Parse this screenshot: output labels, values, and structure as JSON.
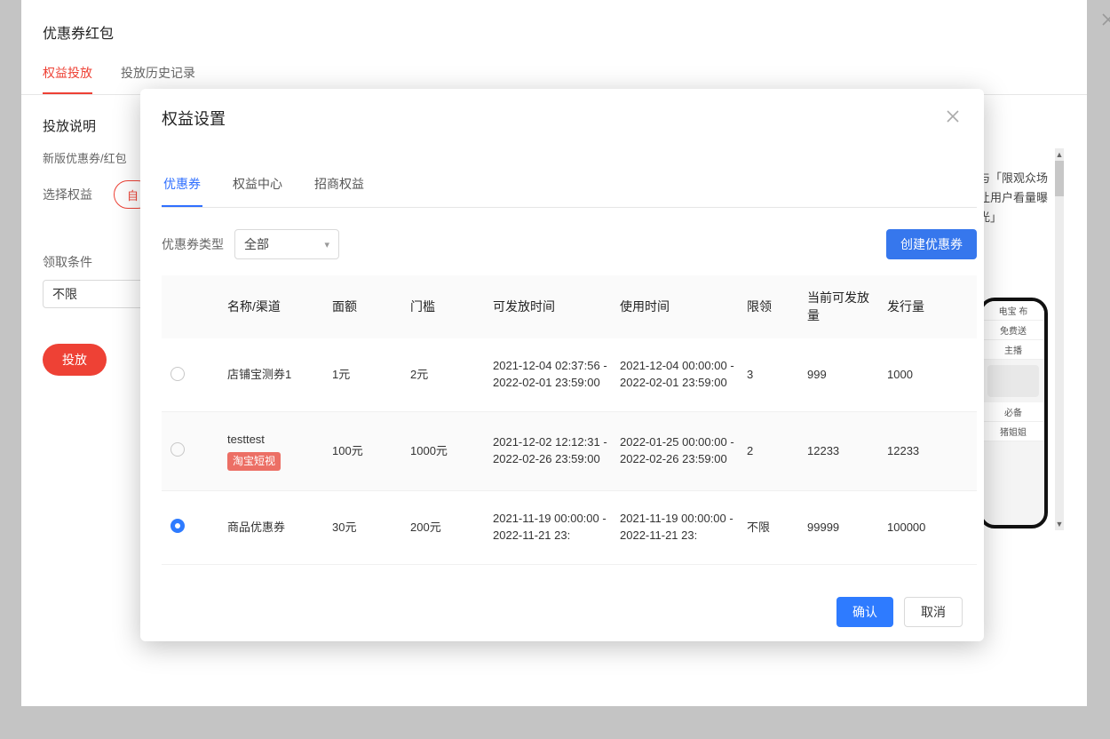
{
  "outer": {
    "title": "优惠券红包",
    "tabs": [
      "权益投放",
      "投放历史记录"
    ],
    "activeTab": 0,
    "sectionTitle": "投放说明",
    "helpText": "新版优惠券/红包",
    "selectBenefitLabel": "选择权益",
    "selectBenefitOption": "自",
    "claimCondLabel": "领取条件",
    "claimCondValue": "不限",
    "submitLabel": "投放",
    "sideNote": "与「限观众场让用户看量曝光」"
  },
  "phone": {
    "strips": [
      "电宝  布",
      "免费送",
      "主播",
      "",
      "必备",
      "猪姐姐"
    ]
  },
  "modal": {
    "title": "权益设置",
    "tabs": [
      "优惠券",
      "权益中心",
      "招商权益"
    ],
    "activeTab": 0,
    "couponTypeLabel": "优惠券类型",
    "couponTypeValue": "全部",
    "createBtn": "创建优惠券",
    "confirmBtn": "确认",
    "cancelBtn": "取消",
    "columns": {
      "name": "名称/渠道",
      "amount": "面额",
      "threshold": "门槛",
      "distTime": "可发放时间",
      "useTime": "使用时间",
      "limit": "限领",
      "available": "当前可发放量",
      "total": "发行量"
    },
    "rows": [
      {
        "selected": false,
        "name": "店铺宝测券1",
        "tag": "",
        "amount": "1元",
        "threshold": "2元",
        "distTime": "2021-12-04 02:37:56 - 2022-02-01 23:59:00",
        "useTime": "2021-12-04 00:00:00 - 2022-02-01 23:59:00",
        "limit": "3",
        "available": "999",
        "total": "1000"
      },
      {
        "selected": false,
        "name": "testtest",
        "tag": "淘宝短视",
        "amount": "100元",
        "threshold": "1000元",
        "distTime": "2021-12-02 12:12:31 - 2022-02-26 23:59:00",
        "useTime": "2022-01-25 00:00:00 - 2022-02-26 23:59:00",
        "limit": "2",
        "available": "12233",
        "total": "12233"
      },
      {
        "selected": true,
        "name": "商品优惠券",
        "tag": "",
        "amount": "30元",
        "threshold": "200元",
        "distTime": "2021-11-19 00:00:00 - 2022-11-21 23:",
        "useTime": "2021-11-19 00:00:00 - 2022-11-21 23:",
        "limit": "不限",
        "available": "99999",
        "total": "100000"
      }
    ]
  }
}
